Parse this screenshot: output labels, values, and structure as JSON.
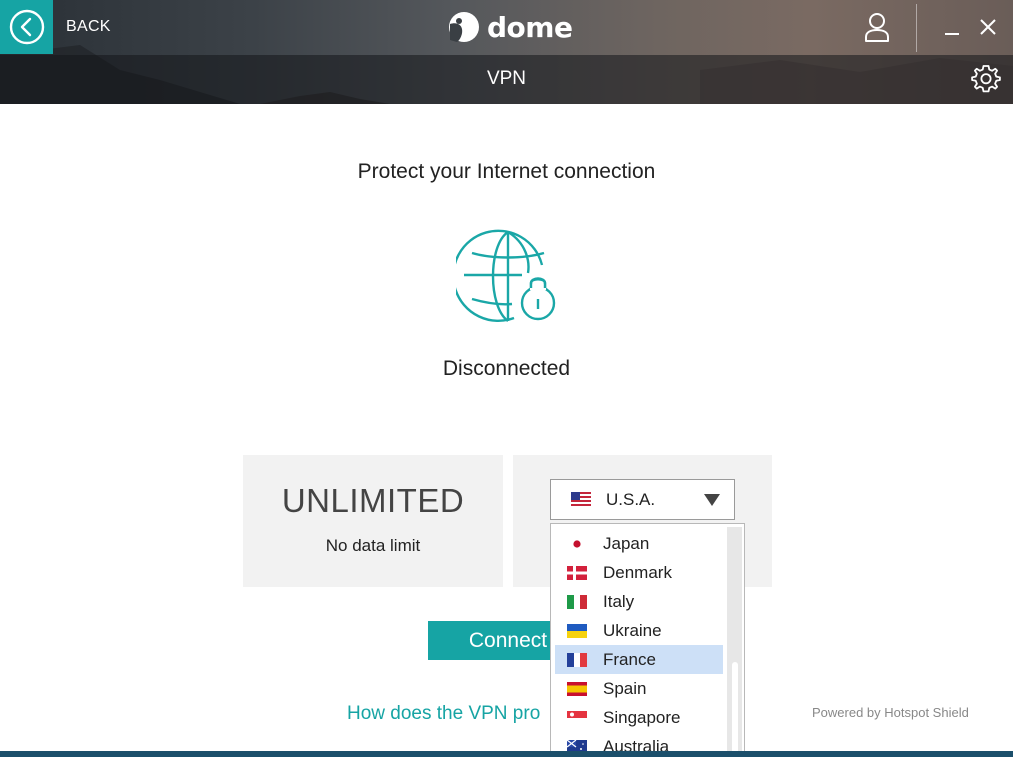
{
  "app": {
    "logo_text": "dome",
    "brand_accent": "#16a4a4"
  },
  "header": {
    "back_label": "BACK",
    "title": "VPN"
  },
  "main": {
    "headline": "Protect your Internet connection",
    "status": "Disconnected",
    "data_plan": "UNLIMITED",
    "data_plan_sub": "No data limit",
    "connect_label": "Connect",
    "howto_link": "How does the VPN pro",
    "powered_by": "Powered by Hotspot Shield"
  },
  "location": {
    "selected": "U.S.A.",
    "selected_flag": "us-flag-icon",
    "options": [
      {
        "label": "Japan",
        "flag": "japan-flag-icon"
      },
      {
        "label": "Denmark",
        "flag": "denmark-flag-icon"
      },
      {
        "label": "Italy",
        "flag": "italy-flag-icon"
      },
      {
        "label": "Ukraine",
        "flag": "ukraine-flag-icon"
      },
      {
        "label": "France",
        "flag": "france-flag-icon",
        "highlighted": true
      },
      {
        "label": "Spain",
        "flag": "spain-flag-icon"
      },
      {
        "label": "Singapore",
        "flag": "singapore-flag-icon"
      },
      {
        "label": "Australia",
        "flag": "australia-flag-icon"
      }
    ]
  }
}
